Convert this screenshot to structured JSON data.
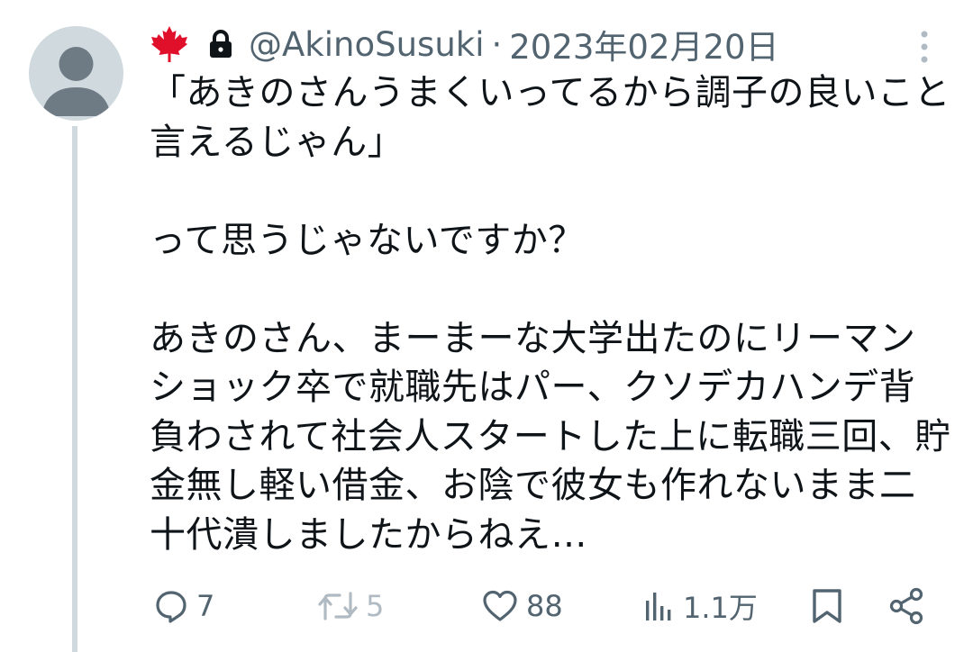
{
  "tweet": {
    "display_name_icons": [
      "maple-leaf-icon",
      "lock-icon"
    ],
    "handle": "@AkinoSusuki",
    "separator": "·",
    "date": "2023年02月20日",
    "text": "「あきのさんうまくいってるから調子の良いこと言えるじゃん」\n\nって思うじゃないですか？\n\nあきのさん、まーまーな大学出たのにリーマンショック卒で就職先はパー、クソデカハンデ背負わされて社会人スタートした上に転職三回、貯金無し軽い借金、お陰で彼女も作れないまま二十代潰しましたからねえ…"
  },
  "actions": {
    "reply_count": "7",
    "retweet_count": "5",
    "like_count": "88",
    "view_count": "1.1万"
  },
  "colors": {
    "secondary_text": "#536471",
    "disabled": "#b0bac2",
    "thread_line": "#cfd9de",
    "maple_red": "#e0102b"
  }
}
